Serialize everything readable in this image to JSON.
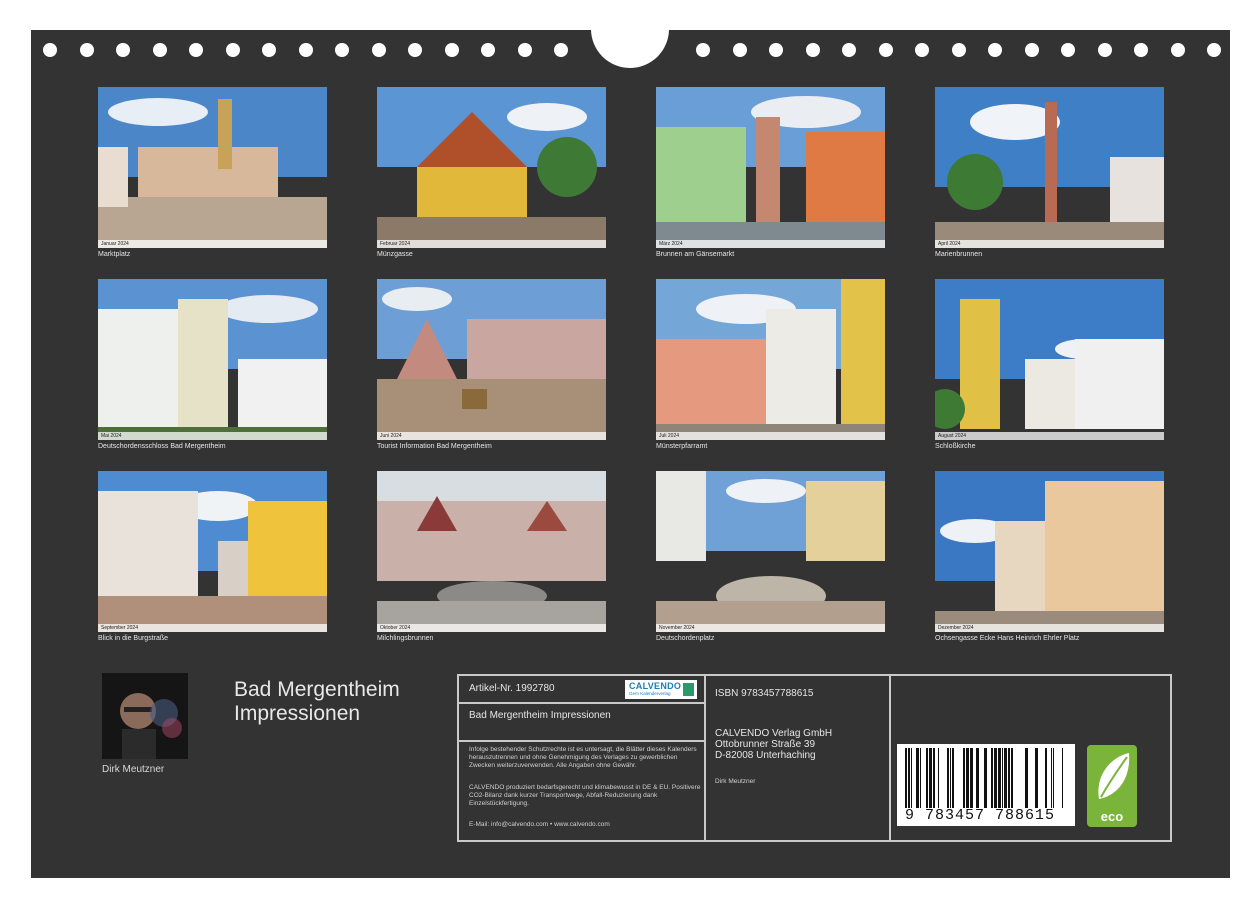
{
  "photos": [
    {
      "caption": "Marktplatz",
      "strip": "Januar 2024"
    },
    {
      "caption": "Münzgasse",
      "strip": "Februar 2024"
    },
    {
      "caption": "Brunnen am Gänsemarkt",
      "strip": "März 2024"
    },
    {
      "caption": "Marienbrunnen",
      "strip": "April 2024"
    },
    {
      "caption": "Deutschordensschloss Bad Mergentheim",
      "strip": "Mai 2024"
    },
    {
      "caption": "Tourist Information Bad Mergentheim",
      "strip": "Juni 2024"
    },
    {
      "caption": "Münsterpfarramt",
      "strip": "Juli 2024"
    },
    {
      "caption": "Schloßkirche",
      "strip": "August 2024"
    },
    {
      "caption": "Blick in die Burgstraße",
      "strip": "September 2024"
    },
    {
      "caption": "Milchlingsbrunnen",
      "strip": "Oktober 2024"
    },
    {
      "caption": "Deutschordenplatz",
      "strip": "November 2024"
    },
    {
      "caption": "Ochsengasse Ecke Hans Heinrich Ehrler Platz",
      "strip": "Dezember 2024"
    }
  ],
  "author": "Dirk Meutzner",
  "title_line1": "Bad Mergentheim",
  "title_line2": "Impressionen",
  "info": {
    "article": "Artikel-Nr. 1992780",
    "logo": "CALVENDO",
    "logo_sub": "Gern Kalenderverlag",
    "calendar_name": "Bad Mergentheim Impressionen",
    "legal1": "Infolge bestehender Schutzrechte ist es untersagt, die Blätter dieses Kalenders herauszutrennen und ohne Genehmigung des Verlages zu gewerblichen Zwecken weiterzuverwenden. Alle Angaben ohne Gewähr.",
    "legal2": "CALVENDO produziert bedarfsgerecht und klimabewusst in DE & EU. Positivere CO2-Bilanz dank kurzer Transportwege, Abfall-Reduzierung dank Einzelstückfertigung.",
    "contact": "E-Mail: info@calvendo.com • www.calvendo.com",
    "isbn": "ISBN 9783457788615",
    "publisher1": "CALVENDO Verlag GmbH",
    "publisher2": "Ottobrunner Straße 39",
    "publisher3": "D-82008 Unterhaching",
    "author_small": "Dirk Meutzner",
    "barcode_number": "9 783457 788615",
    "eco": "eco"
  },
  "colors": {
    "sheet": "#333333",
    "brand": "#1a7fb3",
    "eco": "#7bb43a"
  }
}
